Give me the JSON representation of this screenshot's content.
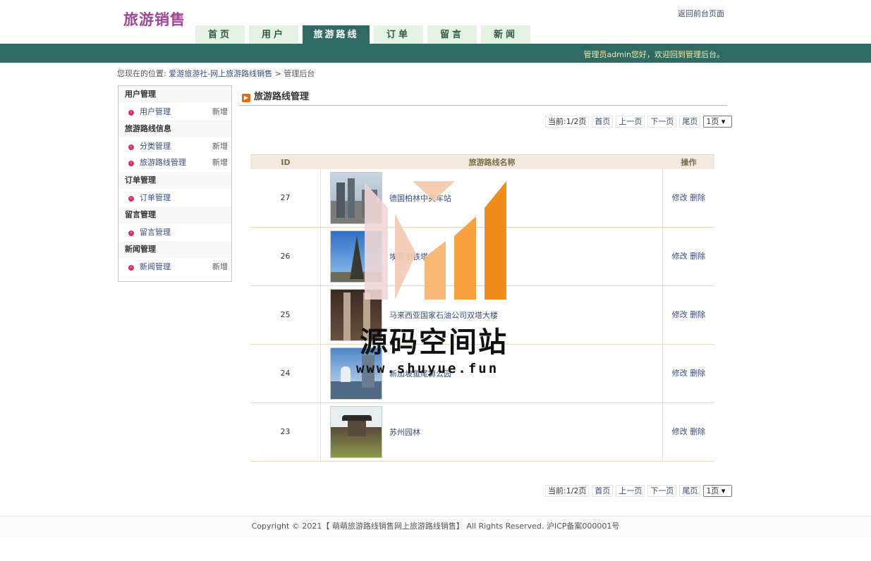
{
  "header": {
    "logo": "旅游销售",
    "return_link": "返回前台页面",
    "tabs": [
      "首页",
      "用户",
      "旅游路线",
      "订单",
      "留言",
      "新闻"
    ],
    "active_tab": "旅游路线",
    "welcome": "管理员admin您好，欢迎回到管理后台。"
  },
  "breadcrumb": {
    "prefix": "您现在的位置:",
    "site": "爱游旅游社-网上旅游路线销售",
    "sep": ">",
    "current": "管理后台"
  },
  "sidebar": {
    "groups": [
      {
        "title": "用户管理",
        "items": [
          {
            "label": "用户管理",
            "add": "新增"
          }
        ]
      },
      {
        "title": "旅游路线信息",
        "items": [
          {
            "label": "分类管理",
            "add": "新增"
          },
          {
            "label": "旅游路线管理",
            "add": "新增"
          }
        ]
      },
      {
        "title": "订单管理",
        "items": [
          {
            "label": "订单管理",
            "add": ""
          }
        ]
      },
      {
        "title": "留言管理",
        "items": [
          {
            "label": "留言管理",
            "add": ""
          }
        ]
      },
      {
        "title": "新闻管理",
        "items": [
          {
            "label": "新闻管理",
            "add": "新增"
          }
        ]
      }
    ]
  },
  "main": {
    "title": "旅游路线管理",
    "pager": {
      "current": "当前:1/2页",
      "first": "首页",
      "prev": "上一页",
      "next": "下一页",
      "last": "尾页",
      "select": "1页"
    },
    "table": {
      "headers": {
        "id": "ID",
        "name": "旅游路线名称",
        "op": "操作"
      },
      "edit": "修改",
      "delete": "删除",
      "rows": [
        {
          "id": "27",
          "name": "德国柏林中央车站",
          "thumb": "berlin"
        },
        {
          "id": "26",
          "name": "埃菲尔铁塔",
          "thumb": "eiffel"
        },
        {
          "id": "25",
          "name": "马来西亚国家石油公司双塔大楼",
          "thumb": "petronas"
        },
        {
          "id": "24",
          "name": "新加坡鱼尾狮公园",
          "thumb": "merlion"
        },
        {
          "id": "23",
          "name": "苏州园林",
          "thumb": "suzhou"
        }
      ]
    }
  },
  "watermark": {
    "text": "源码空间站",
    "url": "www.shuyue.fun"
  },
  "footer": {
    "text": "Copyright © 2021【 萌萌旅游路线销售网上旅游路线销售】 All Rights Reserved. 沪ICP备案000001号"
  },
  "colors": {
    "header_bar": "#2f6a64",
    "tab_bg": "#e4f2e4",
    "logo": "#a0449a",
    "welcome": "#f4e9a8",
    "accent_orange": "#f08c1a"
  }
}
